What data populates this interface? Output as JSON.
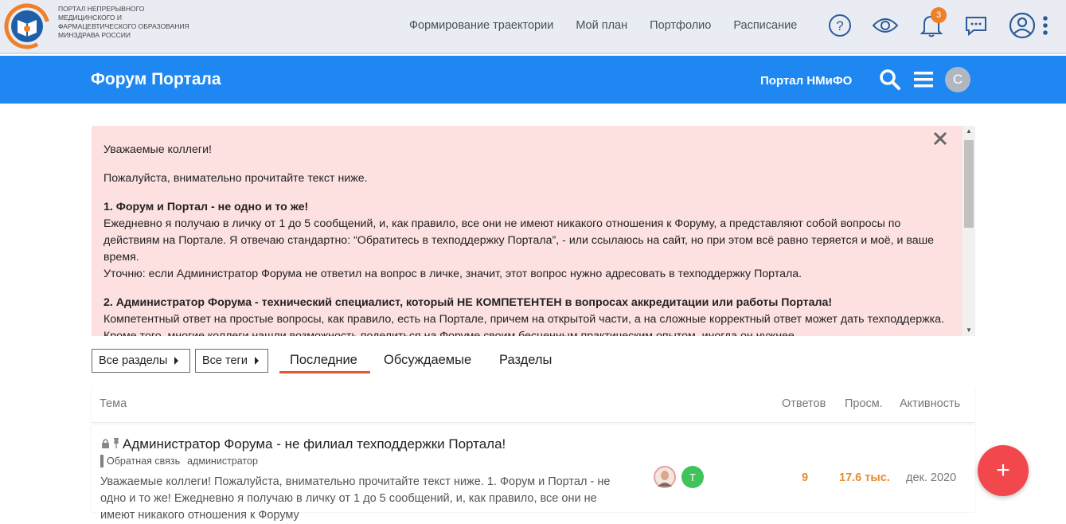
{
  "portal": {
    "logo_text": "ПОРТАЛ НЕПРЕРЫВНОГО МЕДИЦИНСКОГО И ФАРМАЦЕВТИЧЕСКОГО ОБРАЗОВАНИЯ МИНЗДРАВА РОССИИ",
    "nav": [
      "Формирование траектории",
      "Мой план",
      "Портфолио",
      "Расписание"
    ],
    "notifications_count": "3",
    "icons": [
      "help-icon",
      "eye-icon",
      "bell-icon",
      "chat-icon",
      "user-icon",
      "more-vertical-icon"
    ]
  },
  "forum": {
    "title": "Форум Портала",
    "portal_link": "Портал НМиФО",
    "avatar_letter": "С"
  },
  "notice": {
    "greeting": "Уважаемые коллеги!",
    "intro": "Пожалуйста, внимательно прочитайте текст ниже.",
    "p1_title": "1. Форум и Портал - не одно и то же!",
    "p1_text_a": "Ежедневно я получаю в личку от 1 до 5 сообщений, и, как правило, все они не имеют никакого отношения к Форуму, а представляют собой вопросы по действиям на Портале. Я отвечаю стандартно: “Обратитесь в техподдержку Портала”, - или ссылаюсь на сайт, но при этом всё равно теряется и моё, и ваше время.",
    "p1_text_b": "Уточню: если Администратор Форума не ответил на вопрос в личке, значит, этот вопрос нужно адресовать в техподдержку Портала.",
    "p2_title": "2. Администратор Форума - технический специалист, который НЕ КОМПЕТЕНТЕН в вопросах аккредитации или работы Портала!",
    "p2_text": "Компетентный ответ на простые вопросы, как правило, есть на Портале, причем на открытой части, а на сложные корректный ответ может дать техподдержка. Кроме того, многие коллеги нашли возможность поделиться на Форуме своим бесценным практическим опытом, иногда он нужнее."
  },
  "filters": {
    "categories": "Все разделы",
    "tags": "Все теги",
    "tabs": [
      "Последние",
      "Обсуждаемые",
      "Разделы"
    ]
  },
  "table": {
    "headers": {
      "topic": "Тема",
      "replies": "Ответов",
      "views": "Просм.",
      "activity": "Активность"
    },
    "rows": [
      {
        "title": "Администратор Форума - не филиал техподдержки Портала!",
        "category": "Обратная связь",
        "tag": "администратор",
        "excerpt": "Уважаемые коллеги! Пожалуйста, внимательно прочитайте текст ниже. 1. Форум и Портал - не одно и то же! Ежедневно я получаю в личку от 1 до 5 сообщений, и, как правило, все они не имеют никакого отношения к Форуму",
        "poster_letter": "Т",
        "replies": "9",
        "views": "17.6 тыс.",
        "activity": "дек. 2020"
      }
    ]
  },
  "fab_label": "+"
}
